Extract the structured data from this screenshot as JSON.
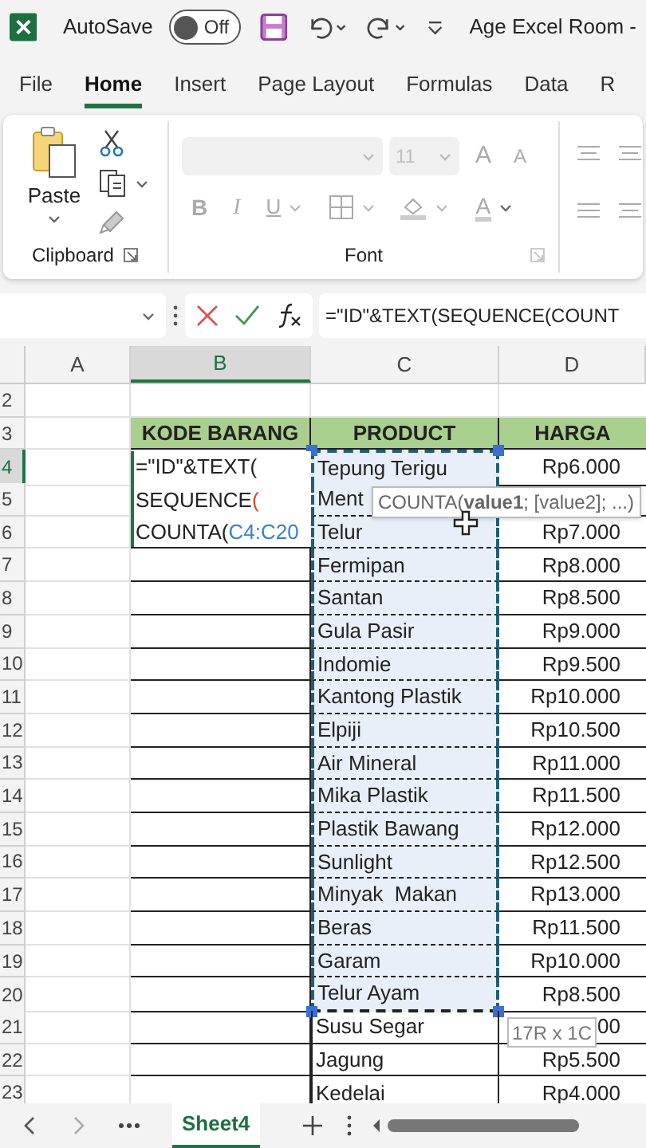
{
  "title_bar": {
    "autosave_label": "AutoSave",
    "autosave": {
      "on": false,
      "label": "Off"
    },
    "title": "Age Excel Room -"
  },
  "ribbon_tabs": [
    {
      "label": "File",
      "selected": false
    },
    {
      "label": "Home",
      "selected": true
    },
    {
      "label": "Insert",
      "selected": false
    },
    {
      "label": "Page Layout",
      "selected": false
    },
    {
      "label": "Formulas",
      "selected": false
    },
    {
      "label": "Data",
      "selected": false
    },
    {
      "label": "R",
      "selected": false
    }
  ],
  "ribbon": {
    "clipboard": {
      "paste_label": "Paste",
      "group_label": "Clipboard"
    },
    "font": {
      "font_size": "11",
      "grow": "A",
      "shrink": "A",
      "bold": "B",
      "italic": "I",
      "underline": "U",
      "font_color": "A",
      "group_label": "Font"
    }
  },
  "formula_bar": {
    "formula": "=\"ID\"&TEXT(SEQUENCE(COUNT"
  },
  "columns": [
    {
      "label": "A",
      "selected": false
    },
    {
      "label": "B",
      "selected": true
    },
    {
      "label": "C",
      "selected": false
    },
    {
      "label": "D",
      "selected": false
    }
  ],
  "rows": [
    {
      "number": "2",
      "selected": false,
      "kind": "empty"
    },
    {
      "number": "3",
      "selected": false,
      "kind": "header",
      "code": "KODE BARANG",
      "product": "PRODUCT",
      "price": "HARGA"
    },
    {
      "number": "4",
      "selected": true,
      "kind": "data",
      "product": "Tepung Terigu",
      "price": "Rp6.000",
      "in_range": true
    },
    {
      "number": "5",
      "selected": false,
      "kind": "data",
      "product": "Ment",
      "in_range": true
    },
    {
      "number": "6",
      "selected": false,
      "kind": "data",
      "product": "Telur",
      "price": "Rp7.000",
      "in_range": true
    },
    {
      "number": "7",
      "selected": false,
      "kind": "data",
      "product": "Fermipan",
      "price": "Rp8.000",
      "in_range": true
    },
    {
      "number": "8",
      "selected": false,
      "kind": "data",
      "product": "Santan",
      "price": "Rp8.500",
      "in_range": true
    },
    {
      "number": "9",
      "selected": false,
      "kind": "data",
      "product": "Gula Pasir",
      "price": "Rp9.000",
      "in_range": true
    },
    {
      "number": "10",
      "selected": false,
      "kind": "data",
      "product": "Indomie",
      "price": "Rp9.500",
      "in_range": true
    },
    {
      "number": "11",
      "selected": false,
      "kind": "data",
      "product": "Kantong Plastik",
      "price": "Rp10.000",
      "in_range": true
    },
    {
      "number": "12",
      "selected": false,
      "kind": "data",
      "product": "Elpiji",
      "price": "Rp10.500",
      "in_range": true
    },
    {
      "number": "13",
      "selected": false,
      "kind": "data",
      "product": "Air Mineral",
      "price": "Rp11.000",
      "in_range": true
    },
    {
      "number": "14",
      "selected": false,
      "kind": "data",
      "product": "Mika Plastik",
      "price": "Rp11.500",
      "in_range": true
    },
    {
      "number": "15",
      "selected": false,
      "kind": "data",
      "product": "Plastik Bawang",
      "price": "Rp12.000",
      "in_range": true
    },
    {
      "number": "16",
      "selected": false,
      "kind": "data",
      "product": "Sunlight",
      "price": "Rp12.500",
      "in_range": true
    },
    {
      "number": "17",
      "selected": false,
      "kind": "data",
      "product": "Minyak  Makan",
      "price": "Rp13.000",
      "in_range": true
    },
    {
      "number": "18",
      "selected": false,
      "kind": "data",
      "product": "Beras",
      "price": "Rp11.500",
      "in_range": true
    },
    {
      "number": "19",
      "selected": false,
      "kind": "data",
      "product": "Garam",
      "price": "Rp10.000",
      "in_range": true
    },
    {
      "number": "20",
      "selected": false,
      "kind": "data",
      "product": "Telur Ayam",
      "price": "Rp8.500",
      "in_range": true
    },
    {
      "number": "21",
      "selected": false,
      "kind": "data",
      "product": "Susu Segar",
      "price": "00",
      "in_range": false
    },
    {
      "number": "22",
      "selected": false,
      "kind": "data",
      "product": "Jagung",
      "price": "Rp5.500",
      "in_range": false
    },
    {
      "number": "23",
      "selected": false,
      "kind": "data",
      "product": "Kedelai",
      "price": "Rp4.000",
      "in_range": false
    }
  ],
  "cell_editor": {
    "lines": [
      [
        {
          "text": "=\"ID\"&TEXT(",
          "kind": "plain"
        }
      ],
      [
        {
          "text": "SEQUENCE",
          "kind": "plain"
        },
        {
          "text": "(",
          "kind": "paren"
        }
      ],
      [
        {
          "text": "COUNTA(",
          "kind": "plain"
        },
        {
          "text": "C4:C20",
          "kind": "reference"
        }
      ]
    ]
  },
  "function_tooltip": "COUNTA(**value1**; [value2]; ...)",
  "size_tooltip": "17R x 1C",
  "sheet_tabs": [
    {
      "label": "Sheet4",
      "selected": true
    }
  ]
}
